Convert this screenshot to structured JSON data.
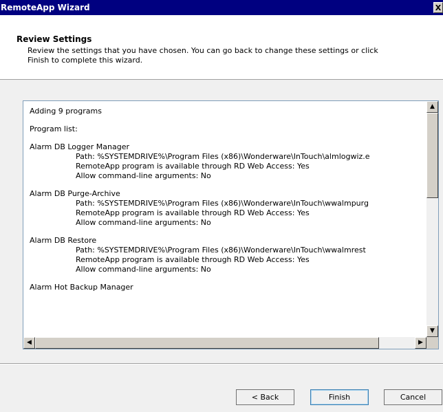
{
  "window": {
    "title": "RemoteApp Wizard",
    "close_label": "X"
  },
  "header": {
    "title": "Review Settings",
    "description": "Review the settings that you have chosen. You can go back to change these settings or click Finish to complete this wizard."
  },
  "summary": {
    "count_line": "Adding 9 programs",
    "list_label": "Program list:",
    "programs": [
      {
        "name": "Alarm DB Logger Manager",
        "path": "Path: %SYSTEMDRIVE%\\Program Files (x86)\\Wonderware\\InTouch\\almlogwiz.e",
        "web_access": "RemoteApp program is available through RD Web Access: Yes",
        "args": "Allow command-line arguments: No"
      },
      {
        "name": "Alarm DB Purge-Archive",
        "path": "Path: %SYSTEMDRIVE%\\Program Files (x86)\\Wonderware\\InTouch\\wwalmpurg",
        "web_access": "RemoteApp program is available through RD Web Access: Yes",
        "args": "Allow command-line arguments: No"
      },
      {
        "name": "Alarm DB Restore",
        "path": "Path: %SYSTEMDRIVE%\\Program Files (x86)\\Wonderware\\InTouch\\wwalmrest",
        "web_access": "RemoteApp program is available through RD Web Access: Yes",
        "args": "Allow command-line arguments: No"
      },
      {
        "name": "Alarm Hot Backup Manager"
      }
    ]
  },
  "scrollbar": {
    "up_arrow": "▲",
    "down_arrow": "▼",
    "left_arrow": "◀",
    "right_arrow": "▶"
  },
  "buttons": {
    "back": "< Back",
    "finish": "Finish",
    "cancel": "Cancel"
  }
}
